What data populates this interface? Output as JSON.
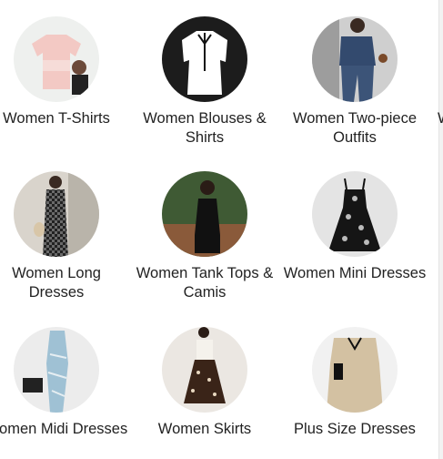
{
  "categories": [
    {
      "label": "Women T-Shirts",
      "icon": "tshirt-product-icon"
    },
    {
      "label": "Women Blouses & Shirts",
      "icon": "blouse-product-icon"
    },
    {
      "label": "Women Two-piece Outfits",
      "icon": "two-piece-outfit-icon"
    },
    {
      "label": "Women Long Dresses",
      "icon": "long-dress-icon"
    },
    {
      "label": "Women Tank Tops & Camis",
      "icon": "tank-top-icon"
    },
    {
      "label": "Women Mini Dresses",
      "icon": "mini-dress-icon"
    },
    {
      "label": "Women Midi Dresses",
      "icon": "midi-dress-icon"
    },
    {
      "label": "Women Skirts",
      "icon": "skirt-icon"
    },
    {
      "label": "Plus Size Dresses",
      "icon": "plus-size-dress-icon"
    }
  ],
  "peek_label": "W",
  "colors": {
    "text": "#222222",
    "background": "#ffffff"
  }
}
